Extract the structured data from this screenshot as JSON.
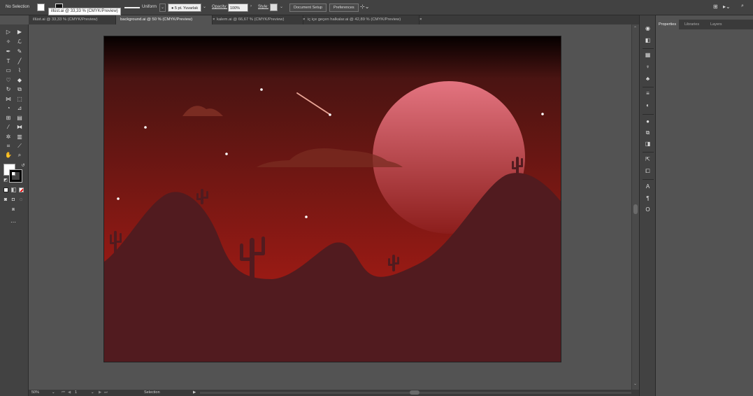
{
  "control_bar": {
    "selection": "No Selection",
    "stroke_profile": "Uniform",
    "brush": "5 pt. Yuvarlak",
    "opacity_label": "Opacity:",
    "opacity_value": "100%",
    "style_label": "Style:",
    "document_setup": "Document Setup",
    "preferences": "Preferences"
  },
  "tooltip": "illüst.ai @ 33,33 % (CMYK/Preview)",
  "tabs": [
    {
      "label": "illüst.ai @ 33,33 % (CMYK/Preview)",
      "active": false
    },
    {
      "label": "background.ai @ 50 % (CMYK/Preview)",
      "active": true
    },
    {
      "label": "kalem.ai @ 66,67 % (CMYK/Preview)",
      "active": false
    },
    {
      "label": "iç içe geçen halkalar.ai @ 42,89 % (CMYK/Preview)",
      "active": false
    }
  ],
  "tab_close": "×",
  "status": {
    "zoom": "50%",
    "artboard": "1",
    "mode": "Selection"
  },
  "panel_tabs": [
    "Properties",
    "Libraries",
    "Layers"
  ],
  "tool_icons": [
    "selection-tool",
    "direct-selection-tool",
    "magic-wand-tool",
    "lasso-tool",
    "pen-tool",
    "curvature-tool",
    "type-tool",
    "line-tool",
    "rectangle-tool",
    "paintbrush-tool",
    "shaper-tool",
    "eraser-tool",
    "rotate-tool",
    "scale-tool",
    "width-tool",
    "free-transform-tool",
    "shape-builder-tool",
    "perspective-grid-tool",
    "mesh-tool",
    "gradient-tool",
    "eyedropper-tool",
    "blend-tool",
    "symbol-sprayer-tool",
    "column-graph-tool",
    "artboard-tool",
    "slice-tool",
    "hand-tool",
    "zoom-tool"
  ],
  "colors": {
    "sky_top": "#050000",
    "sky_mid": "#4a1412",
    "sky_bottom": "#9a1a14",
    "sun_top": "#e37480",
    "sun_bottom": "#8c1e1c",
    "hills": "#511b1f",
    "cloud": "#7a2c22",
    "star": "#ffffff"
  }
}
